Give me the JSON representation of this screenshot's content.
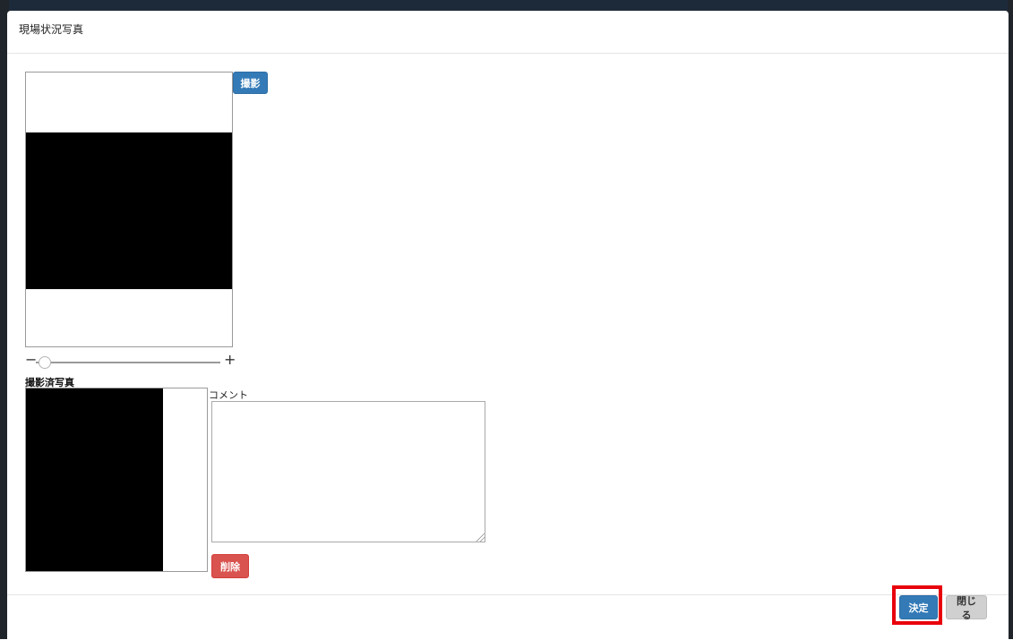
{
  "modal": {
    "title": "現場状況写真"
  },
  "camera": {
    "capture_label": "撮影",
    "zoom_minus": "−",
    "zoom_plus": "+",
    "zoom_level": 0.05
  },
  "captured": {
    "section_label": "撮影済写真",
    "comment_label": "コメント",
    "comment_value": "",
    "delete_label": "削除"
  },
  "footer": {
    "confirm_label": "決定",
    "close_label": "閉じる"
  },
  "colors": {
    "primary": "#337ab7",
    "danger": "#d9534f",
    "default": "#d0d0d0",
    "highlight": "#e8000b"
  }
}
